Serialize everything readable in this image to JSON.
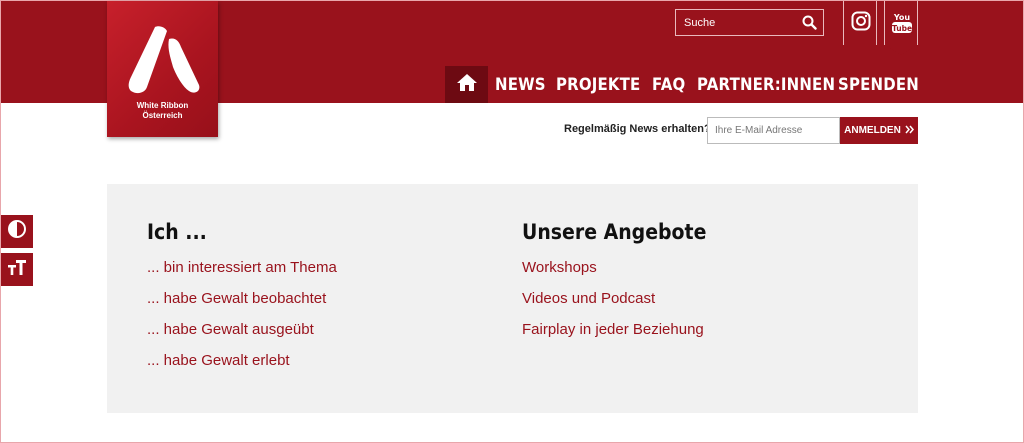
{
  "logo": {
    "line1": "White Ribbon",
    "line2": "Österreich"
  },
  "search": {
    "placeholder": "Suche",
    "icon": "search-icon"
  },
  "social": [
    {
      "name": "Instagram",
      "icon": "instagram-icon"
    },
    {
      "name": "YouTube",
      "icon": "youtube-icon",
      "line1": "You",
      "line2": "Tube"
    }
  ],
  "nav": {
    "home_icon": "home-icon",
    "items": [
      "NEWS",
      "PROJEKTE",
      "FAQ",
      "PARTNER:INNEN",
      "SPENDEN"
    ]
  },
  "newsletter": {
    "label": "Regelmäßig News erhalten?",
    "placeholder": "Ihre E-Mail Adresse",
    "button": "ANMELDEN",
    "button_icon": "double-chevron-right-icon"
  },
  "accessibility": {
    "contrast_icon": "contrast-icon",
    "font_size_icon": "font-size-icon"
  },
  "panel": {
    "left": {
      "title": "Ich ...",
      "links": [
        "... bin interessiert am Thema",
        "... habe Gewalt beobachtet",
        "... habe Gewalt ausgeübt",
        "... habe Gewalt erlebt"
      ]
    },
    "right": {
      "title": "Unsere Angebote",
      "links": [
        "Workshops",
        "Videos und Podcast",
        "Fairplay in jeder Beziehung"
      ]
    }
  },
  "colors": {
    "brand": "#99121c",
    "brand_dark": "#6d0a12",
    "panel_bg": "#f1f1f1"
  }
}
